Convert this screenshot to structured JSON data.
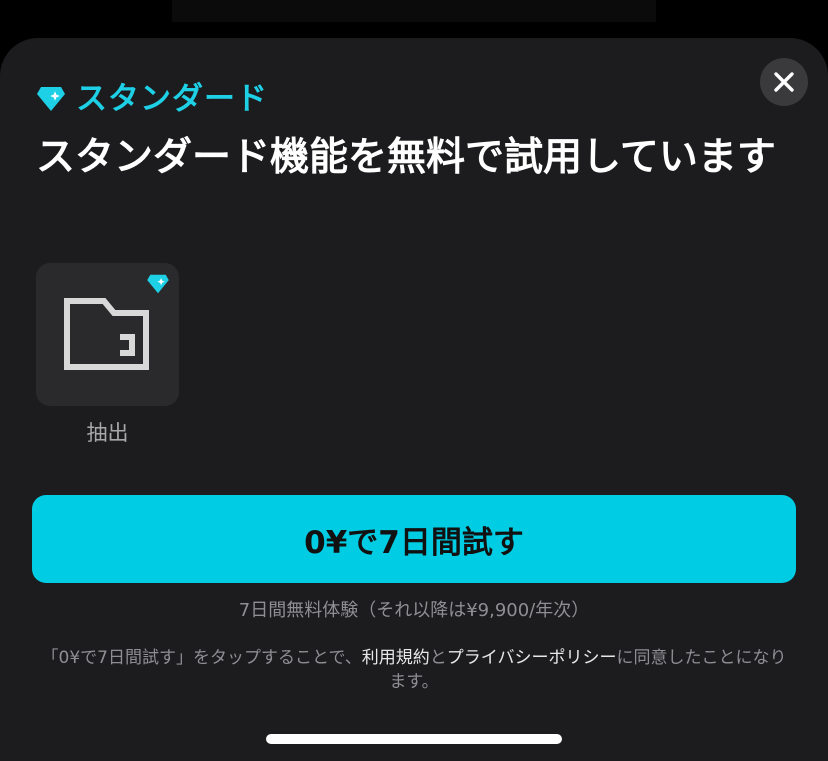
{
  "colors": {
    "accent": "#1ed0e6",
    "cta_background": "#00cde3",
    "sheet_background": "#1c1c1e",
    "card_background": "#2a2a2c",
    "muted_text": "#8e8e93",
    "headline_text": "#ffffff"
  },
  "header": {
    "brand_icon": "diamond-icon",
    "brand_label": "スタンダード",
    "close_icon": "close-icon"
  },
  "headline": "スタンダード機能を無料で試用しています",
  "feature": {
    "icon": "folder-icon",
    "badge_icon": "diamond-icon",
    "label": "抽出"
  },
  "cta": {
    "label": "0¥で7日間試す"
  },
  "trial_note": "7日間無料体験（それ以降は¥9,900/年次）",
  "terms": {
    "prefix": "「0¥で7日間試す」をタップすることで、",
    "terms_link": "利用規約",
    "conjunction": "と",
    "privacy_link": "プライバシーポリシー",
    "suffix": "に同意したことになります。"
  }
}
